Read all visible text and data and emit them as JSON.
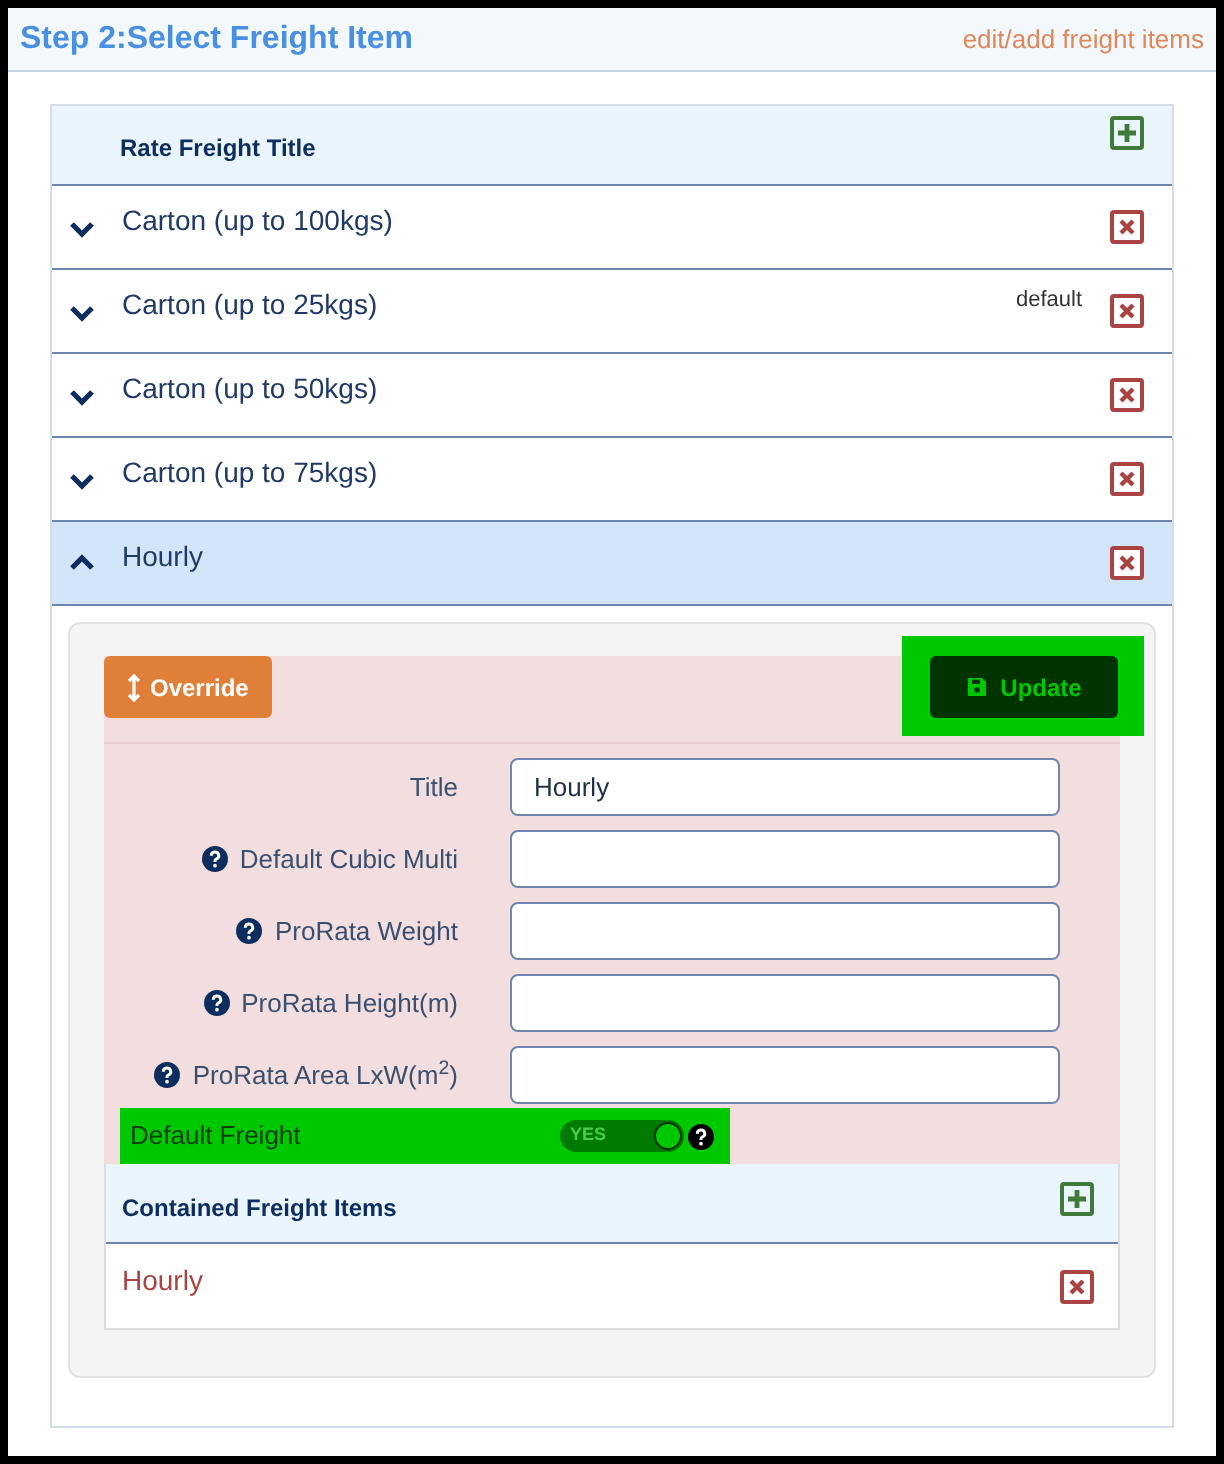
{
  "header": {
    "title": "Step 2:Select Freight Item",
    "link": "edit/add freight items"
  },
  "table": {
    "title": "Rate Freight Title",
    "rows": [
      {
        "title": "Carton (up to 100kgs)",
        "expanded": false
      },
      {
        "title": "Carton (up to 25kgs)",
        "expanded": false,
        "badge": "default"
      },
      {
        "title": "Carton (up to 50kgs)",
        "expanded": false
      },
      {
        "title": "Carton (up to 75kgs)",
        "expanded": false
      },
      {
        "title": "Hourly",
        "expanded": true
      }
    ]
  },
  "detail": {
    "override_button": "Override",
    "update_button": "Update",
    "fields": [
      {
        "label": "Title",
        "help": false,
        "value": "Hourly"
      },
      {
        "label": "Default Cubic Multi",
        "help": true
      },
      {
        "label": "ProRata Weight",
        "help": true
      },
      {
        "label": "ProRata Height(m)",
        "help": true
      },
      {
        "label": "ProRata Area LxW(m$^{2}$)",
        "help": true
      }
    ],
    "default_freight": {
      "label": "Default Freight",
      "toggle_text": "YES",
      "on": true
    },
    "contained": {
      "title": "Contained Freight Items",
      "items": [
        "Hourly"
      ]
    }
  }
}
